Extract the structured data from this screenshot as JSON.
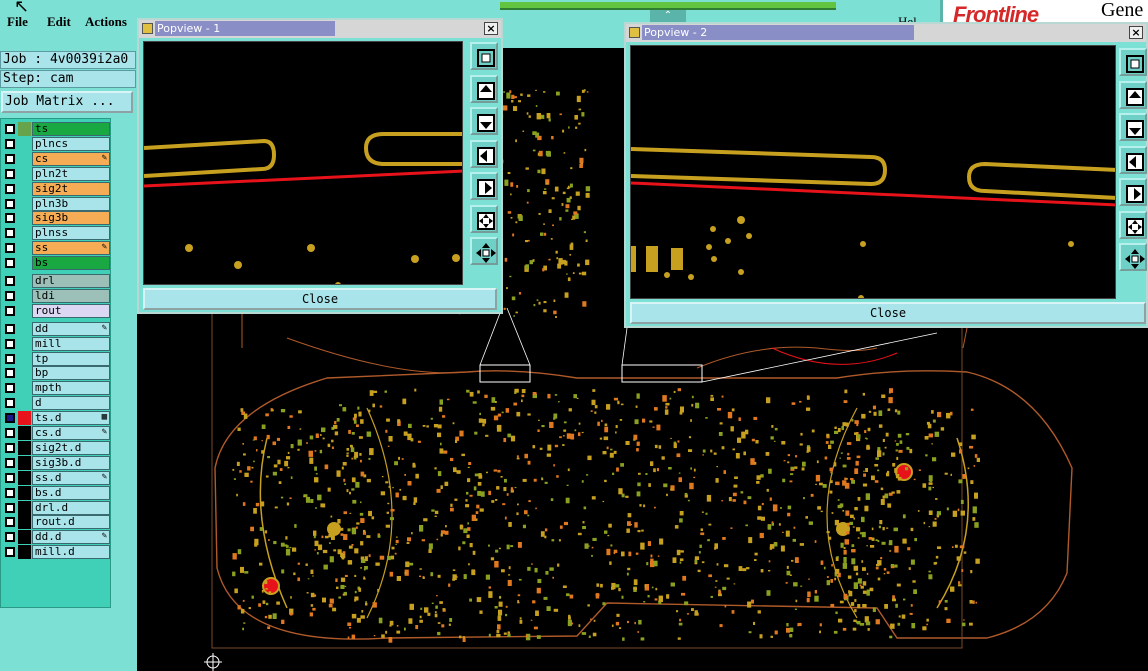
{
  "menu": {
    "file": "File",
    "edit": "Edit",
    "actions": "Actions"
  },
  "header": {
    "brand": "Frontline",
    "brand_suffix": "Gene",
    "help_label": "Hel"
  },
  "job": {
    "name_line": "Job : 4v0039i2a0",
    "step_line": "Step: cam",
    "matrix_button": "Job Matrix ..."
  },
  "layers": [
    {
      "name": "ts",
      "color": "#1aa843",
      "swatch": "#67a34a"
    },
    {
      "name": "plncs",
      "color": "#a9e4ea"
    },
    {
      "name": "cs",
      "color": "#f5ac55",
      "mark": "✎"
    },
    {
      "name": "pln2t",
      "color": "#a9e4ea"
    },
    {
      "name": "sig2t",
      "color": "#f5ac55"
    },
    {
      "name": "pln3b",
      "color": "#a9e4ea"
    },
    {
      "name": "sig3b",
      "color": "#f5ac55"
    },
    {
      "name": "plnss",
      "color": "#a9e4ea"
    },
    {
      "name": "ss",
      "color": "#f5ac55",
      "mark": "✎"
    },
    {
      "name": "bs",
      "color": "#1aa843"
    },
    {
      "name": "drl",
      "color": "#9cc0b8"
    },
    {
      "name": "ldi",
      "color": "#9cc0b8"
    },
    {
      "name": "rout",
      "color": "#dcd8f4"
    },
    {
      "name": "dd",
      "color": "#a9e4ea",
      "mark": "✎"
    },
    {
      "name": "mill",
      "color": "#a9e4ea"
    },
    {
      "name": "tp",
      "color": "#a9e4ea"
    },
    {
      "name": "bp",
      "color": "#a9e4ea"
    },
    {
      "name": "mpth",
      "color": "#a9e4ea"
    },
    {
      "name": "d",
      "color": "#a9e4ea"
    },
    {
      "name": "ts.d",
      "color": "#a9e4ea",
      "swatch": "#e8121a",
      "mark": "▦",
      "checked": true
    },
    {
      "name": "cs.d",
      "color": "#a9e4ea",
      "swatch": "#000000",
      "mark": "✎"
    },
    {
      "name": "sig2t.d",
      "color": "#a9e4ea",
      "swatch": "#000000"
    },
    {
      "name": "sig3b.d",
      "color": "#a9e4ea",
      "swatch": "#000000"
    },
    {
      "name": "ss.d",
      "color": "#a9e4ea",
      "swatch": "#000000",
      "mark": "✎"
    },
    {
      "name": "bs.d",
      "color": "#a9e4ea",
      "swatch": "#000000"
    },
    {
      "name": "drl.d",
      "color": "#a9e4ea",
      "swatch": "#000000"
    },
    {
      "name": "rout.d",
      "color": "#a9e4ea",
      "swatch": "#000000"
    },
    {
      "name": "dd.d",
      "color": "#a9e4ea",
      "swatch": "#000000",
      "mark": "✎"
    },
    {
      "name": "mill.d",
      "color": "#a9e4ea",
      "swatch": "#000000"
    }
  ],
  "popview1": {
    "title": "Popview - 1",
    "close_button": "Close",
    "close_icon": "×"
  },
  "popview2": {
    "title": "Popview - 2",
    "close_button": "Close",
    "close_icon": "×"
  },
  "popview_tools": [
    "zoom-page-icon",
    "pan-up-icon",
    "pan-down-icon",
    "pan-left-icon",
    "pan-right-icon",
    "zoom-in-icon",
    "zoom-out-icon"
  ],
  "colors": {
    "background": "#7de0d4",
    "board_copper": "#c8a020",
    "trace_red": "#e8121a",
    "pad_orange": "#e07820",
    "outline": "#b05a2a"
  }
}
